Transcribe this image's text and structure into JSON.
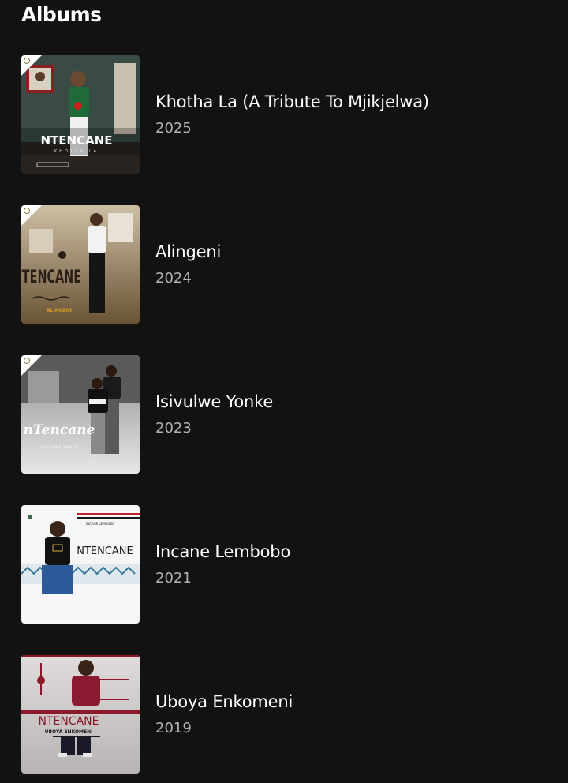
{
  "section": {
    "title": "Albums"
  },
  "albums": [
    {
      "title": "Khotha La (A Tribute To Mjikjelwa)",
      "year": "2025",
      "cover_text": "NTENCANE",
      "cover_subtext": "KHOTHA LA",
      "badge": true
    },
    {
      "title": "Alingeni",
      "year": "2024",
      "cover_text": "NTENCANE",
      "cover_subtext": "ALINGENI",
      "badge": true
    },
    {
      "title": "Isivulwe Yonke",
      "year": "2023",
      "cover_text": "nTencane",
      "cover_subtext": "ISIVULWE YONKE",
      "badge": true
    },
    {
      "title": "Incane Lembobo",
      "year": "2021",
      "cover_text": "NTENCANE",
      "cover_subtext": "INCANE LEMBOBO",
      "badge": false
    },
    {
      "title": "Uboya Enkomeni",
      "year": "2019",
      "cover_text": "NTENCANE",
      "cover_subtext": "UBOYA ENKOMENI",
      "badge": false
    }
  ],
  "colors": {
    "background": "#121212",
    "title": "#ffffff",
    "year": "#b3b3b3"
  }
}
